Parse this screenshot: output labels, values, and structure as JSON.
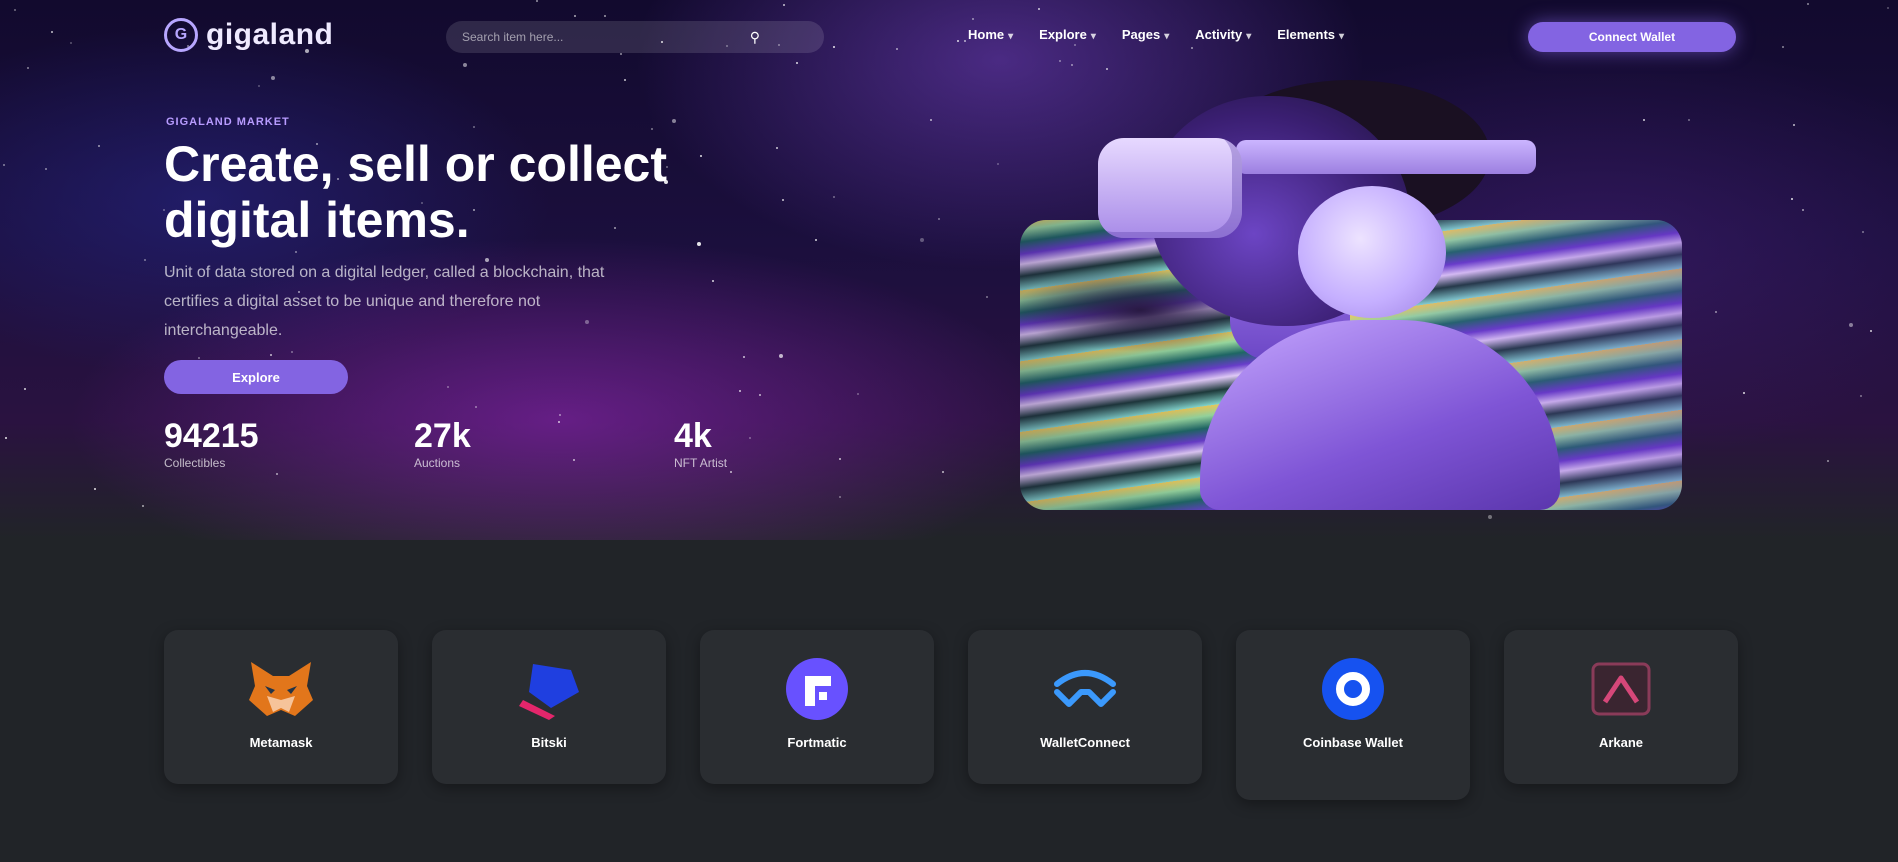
{
  "nav": {
    "brand": "gigaland",
    "search_placeholder": "Search item here...",
    "menu": [
      {
        "label": "Home"
      },
      {
        "label": "Explore"
      },
      {
        "label": "Pages"
      },
      {
        "label": "Activity"
      },
      {
        "label": "Elements"
      }
    ],
    "connect_label": "Connect Wallet"
  },
  "hero": {
    "tagline": "Gigaland Market",
    "title_line1": "Create, sell or collect",
    "title_line2": "digital items.",
    "text_line1": "Unit of data stored on a digital ledger, called a blockchain, that",
    "text_line2": "certifies a digital asset to be unique and therefore not",
    "text_line3": "interchangeable.",
    "explore_label": "Explore",
    "stats": [
      {
        "value": "94215",
        "label": "Collectibles"
      },
      {
        "value": "27k",
        "label": "Auctions"
      },
      {
        "value": "4k",
        "label": "NFT Artist"
      }
    ]
  },
  "wallets": [
    {
      "label": "Metamask",
      "icon": "metamask-fox-icon"
    },
    {
      "label": "Bitski",
      "icon": "bitski-icon"
    },
    {
      "label": "Fortmatic",
      "icon": "fortmatic-icon"
    },
    {
      "label": "WalletConnect",
      "icon": "walletconnect-icon"
    },
    {
      "label": "Coinbase Wallet",
      "icon": "coinbase-icon"
    },
    {
      "label": "Arkane",
      "icon": "arkane-icon"
    }
  ],
  "colors": {
    "accent": "#8364e2",
    "background": "#212428",
    "card": "#2a2d31"
  }
}
